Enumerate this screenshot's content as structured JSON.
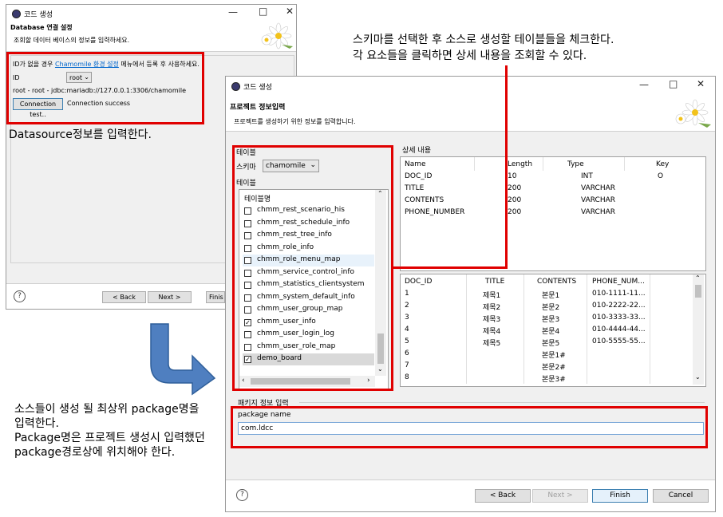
{
  "back_window": {
    "title": "코드 생성",
    "header_title": "Database 연결 설정",
    "header_desc": "조회할 데이터 베이스의 정보를 입력하세요.",
    "id_hint_prefix": "ID가 없을 경우 ",
    "id_hint_link": "Chamomile 환경 설정",
    "id_hint_suffix": " 메뉴에서 등록 후 사용하세요.",
    "id_label": "ID",
    "id_value": "root",
    "conn_info": "root - root - jdbc:mariadb://127.0.0.1:3306/chamomile",
    "conn_test_button": "Connection test..",
    "conn_status": "Connection success",
    "back_button": "< Back",
    "next_button": "Next >",
    "finish_button": "Finis"
  },
  "front_window": {
    "title": "코드 생성",
    "header_title": "프로젝트 정보입력",
    "header_desc": "프로젝트를 생성하기 위한 정보를 입력합니다.",
    "table_group_label": "테이블",
    "schema_label": "스키마",
    "schema_value": "chamomile",
    "table_label": "테이블",
    "table_list_header": "테이블명",
    "tables": [
      {
        "name": "chmm_rest_scenario_his",
        "checked": false
      },
      {
        "name": "chmm_rest_schedule_info",
        "checked": false
      },
      {
        "name": "chmm_rest_tree_info",
        "checked": false
      },
      {
        "name": "chmm_role_info",
        "checked": false
      },
      {
        "name": "chmm_role_menu_map",
        "checked": false
      },
      {
        "name": "chmm_service_control_info",
        "checked": false
      },
      {
        "name": "chmm_statistics_clientsystem",
        "checked": false
      },
      {
        "name": "chmm_system_default_info",
        "checked": false
      },
      {
        "name": "chmm_user_group_map",
        "checked": false
      },
      {
        "name": "chmm_user_info",
        "checked": true
      },
      {
        "name": "chmm_user_login_log",
        "checked": false
      },
      {
        "name": "chmm_user_role_map",
        "checked": false
      },
      {
        "name": "demo_board",
        "checked": true
      }
    ],
    "detail_group_label": "상세 내용",
    "columns_header": [
      "Name",
      "Length",
      "Type",
      "Key"
    ],
    "columns_rows": [
      [
        "DOC_ID",
        "10",
        "INT",
        "O"
      ],
      [
        "TITLE",
        "200",
        "VARCHAR",
        ""
      ],
      [
        "CONTENTS",
        "200",
        "VARCHAR",
        ""
      ],
      [
        "PHONE_NUMBER",
        "200",
        "VARCHAR",
        ""
      ]
    ],
    "data_header": [
      "DOC_ID",
      "TITLE",
      "CONTENTS",
      "PHONE_NUM..."
    ],
    "data_rows": [
      [
        "1",
        "제목1",
        "본문1",
        "010-1111-11..."
      ],
      [
        "2",
        "제목2",
        "본문2",
        "010-2222-22..."
      ],
      [
        "3",
        "제목3",
        "본문3",
        "010-3333-33..."
      ],
      [
        "4",
        "제목4",
        "본문4",
        "010-4444-44..."
      ],
      [
        "5",
        "제목5",
        "본문5",
        "010-5555-55..."
      ],
      [
        "6",
        "",
        "본문1#",
        ""
      ],
      [
        "7",
        "",
        "본문2#",
        ""
      ],
      [
        "8",
        "",
        "본문3#",
        ""
      ]
    ],
    "package_group_label": "패키지 정보 입력",
    "package_label": "package name",
    "package_value": "com.ldcc",
    "back_button": "< Back",
    "next_button": "Next >",
    "finish_button": "Finish",
    "cancel_button": "Cancel"
  },
  "annotations": {
    "top_right_line1": "스키마를 선택한 후 소스로 생성할 테이블들을 체크한다.",
    "top_right_line2": "각 요소들을 클릭하면 상세 내용을 조회할 수 있다.",
    "datasource_note": "Datasource정보를 입력한다.",
    "package_note_line1": "소스들이 생성 될 최상위 package명을",
    "package_note_line2": "입력한다.",
    "package_note_line3": "Package명은 프로젝트 생성시 입력했던",
    "package_note_line4": "package경로상에 위치해야 한다."
  },
  "colors": {
    "highlight_red": "#e00000",
    "arrow_blue": "#4f7fc0",
    "link_blue": "#0066cc",
    "selected_row": "#cce8ff"
  }
}
